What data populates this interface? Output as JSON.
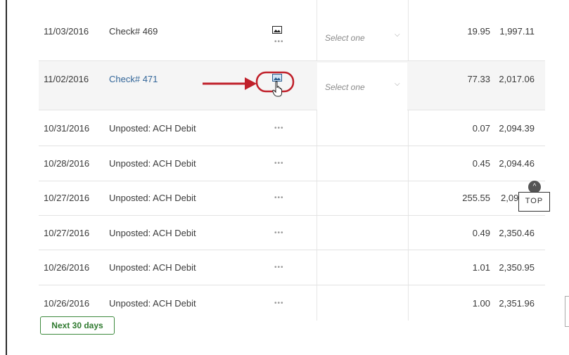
{
  "transactions": [
    {
      "date": "11/03/2016",
      "description": "Check# 469",
      "amount": "19.95",
      "balance": "1,997.11",
      "has_image": true,
      "category": "Select one"
    },
    {
      "date": "11/02/2016",
      "description": "Check# 471",
      "amount": "77.33",
      "balance": "2,017.06",
      "has_image": true,
      "category": "Select one"
    },
    {
      "date": "10/31/2016",
      "description": "Unposted: ACH Debit",
      "amount": "0.07",
      "balance": "2,094.39"
    },
    {
      "date": "10/28/2016",
      "description": "Unposted: ACH Debit",
      "amount": "0.45",
      "balance": "2,094.46"
    },
    {
      "date": "10/27/2016",
      "description": "Unposted: ACH Debit",
      "amount": "255.55",
      "balance": "2,094."
    },
    {
      "date": "10/27/2016",
      "description": "Unposted: ACH Debit",
      "amount": "0.49",
      "balance": "2,350.46"
    },
    {
      "date": "10/26/2016",
      "description": "Unposted: ACH Debit",
      "amount": "1.01",
      "balance": "2,350.95"
    },
    {
      "date": "10/26/2016",
      "description": "Unposted: ACH Debit",
      "amount": "1.00",
      "balance": "2,351.96"
    }
  ],
  "row_menu_glyph": "•••",
  "dropdown_chevron": "⌵",
  "next_button": {
    "label": "Next 30 days"
  },
  "top_button": {
    "label": "TOP",
    "icon": "chevron-up-icon"
  },
  "annotation": {
    "arrow_color": "#c0202a",
    "highlight_color": "#c0202a"
  },
  "colors": {
    "link": "#336699",
    "button_green": "#2f7a2f"
  }
}
